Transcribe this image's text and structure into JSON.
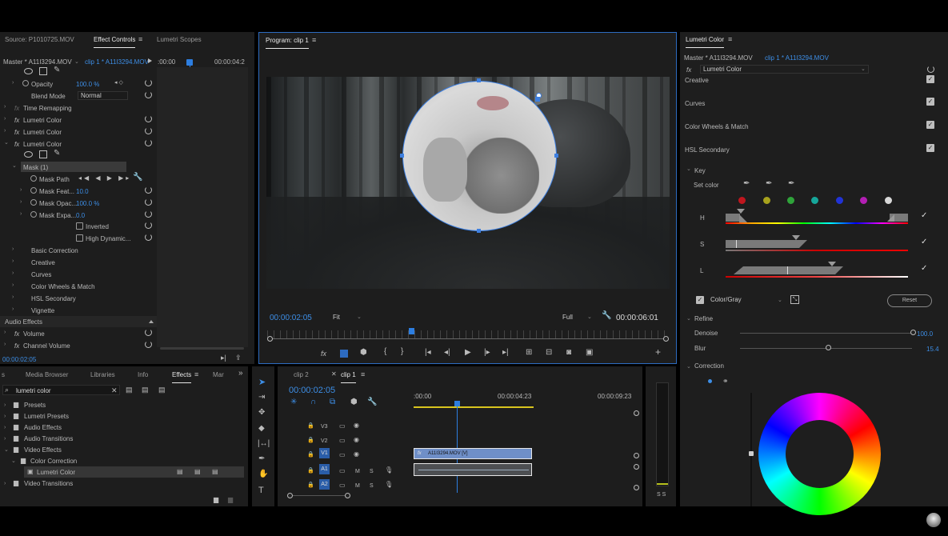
{
  "source_panel": {
    "tabs": [
      "Source: P1010725.MOV",
      "Effect Controls",
      "Lumetri Scopes"
    ],
    "master": "Master * A11I3294.MOV",
    "clip": "clip 1 * A11I3294.MOV",
    "ruler_start": ":00:00",
    "ruler_end": "00:00:04:2",
    "rows": [
      {
        "label": "Opacity",
        "value": "100.0 %"
      },
      {
        "label": "Blend Mode",
        "value": "Normal"
      },
      {
        "label": "Time Remapping"
      },
      {
        "label": "Lumetri Color"
      },
      {
        "label": "Lumetri Color"
      },
      {
        "label": "Lumetri Color"
      },
      {
        "label": "Mask (1)"
      },
      {
        "label": "Mask Path"
      },
      {
        "label": "Mask Feat...",
        "value": "10.0"
      },
      {
        "label": "Mask Opac...",
        "value": "100.0 %"
      },
      {
        "label": "Mask Expa...",
        "value": "0.0"
      },
      {
        "label": "Inverted"
      },
      {
        "label": "High Dynamic..."
      },
      {
        "label": "Basic Correction"
      },
      {
        "label": "Creative"
      },
      {
        "label": "Curves"
      },
      {
        "label": "Color Wheels & Match"
      },
      {
        "label": "HSL Secondary"
      },
      {
        "label": "Vignette"
      },
      {
        "label": "Audio Effects"
      },
      {
        "label": "Volume"
      },
      {
        "label": "Channel Volume"
      }
    ],
    "timecode": "00:00:02:05"
  },
  "program": {
    "title": "Program: clip 1",
    "timecode": "00:00:02:05",
    "fit": "Fit",
    "quality": "Full",
    "duration": "00:00:06:01"
  },
  "lumetri": {
    "title": "Lumetri Color",
    "master": "Master * A11I3294.MOV",
    "clip": "clip 1 * A11I3294.MOV",
    "effect": "Lumetri Color",
    "sections": [
      "Creative",
      "Curves",
      "Color Wheels & Match",
      "HSL Secondary"
    ],
    "key": "Key",
    "set_color": "Set color",
    "swatches": [
      "#c0161e",
      "#a7a21d",
      "#2fa33a",
      "#16a69a",
      "#2133d6",
      "#b31fb4",
      "#d8d8d8"
    ],
    "h": "H",
    "s": "S",
    "l": "L",
    "mode": "Color/Gray",
    "reset": "Reset",
    "refine": "Refine",
    "denoise": "Denoise",
    "denoise_val": "100.0",
    "blur": "Blur",
    "blur_val": "15.4",
    "correction": "Correction"
  },
  "effects_panel": {
    "tabs": [
      "s",
      "Media Browser",
      "Libraries",
      "Info",
      "Effects",
      "Mar"
    ],
    "search": "lumetri color",
    "tree": [
      "Presets",
      "Lumetri Presets",
      "Audio Effects",
      "Audio Transitions",
      "Video Effects",
      "Color Correction",
      "Lumetri Color",
      "Video Transitions"
    ]
  },
  "timeline": {
    "tabs": [
      "clip 2",
      "clip 1"
    ],
    "timecode": "00:00:02:05",
    "ruler": [
      ":00:00",
      "00:00:04:23",
      "00:00:09:23"
    ],
    "tracks": [
      "V3",
      "V2",
      "V1",
      "A1",
      "A2"
    ],
    "m": "M",
    "s": "S",
    "clip_label": "A11I3294.MOV [V]",
    "meter": "S S"
  }
}
